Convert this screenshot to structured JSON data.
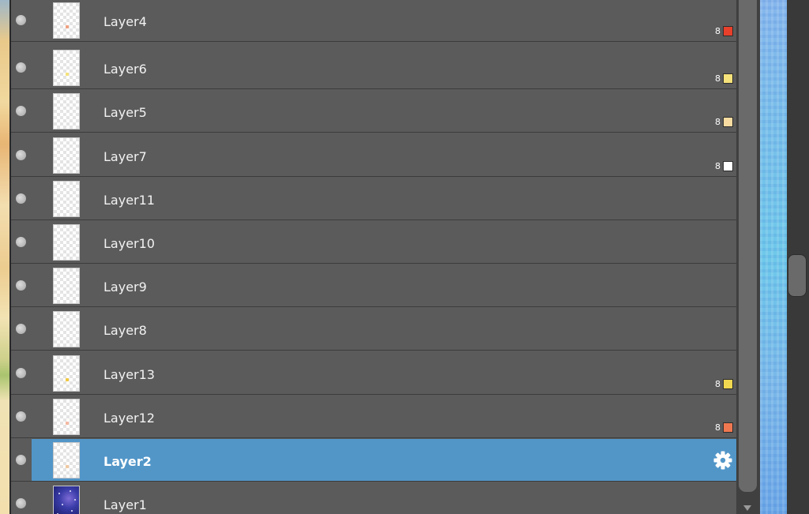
{
  "layers": [
    {
      "name": "Layer4",
      "tag": "8",
      "tag_color": "#e8402a",
      "thumb_mark": "#f0a080",
      "selected": false
    },
    {
      "name": "Layer6",
      "tag": "8",
      "tag_color": "#f6e27a",
      "thumb_mark": "#f4e27a",
      "selected": false
    },
    {
      "name": "Layer5",
      "tag": "8",
      "tag_color": "#f8dba0",
      "thumb_mark": null,
      "selected": false
    },
    {
      "name": "Layer7",
      "tag": "8",
      "tag_color": "#ffffff",
      "thumb_mark": null,
      "selected": false
    },
    {
      "name": "Layer11",
      "tag": null,
      "tag_color": null,
      "thumb_mark": null,
      "selected": false
    },
    {
      "name": "Layer10",
      "tag": null,
      "tag_color": null,
      "thumb_mark": null,
      "selected": false
    },
    {
      "name": "Layer9",
      "tag": null,
      "tag_color": null,
      "thumb_mark": null,
      "selected": false
    },
    {
      "name": "Layer8",
      "tag": null,
      "tag_color": null,
      "thumb_mark": null,
      "selected": false
    },
    {
      "name": "Layer13",
      "tag": "8",
      "tag_color": "#f0d850",
      "thumb_mark": "#f0c840",
      "selected": false
    },
    {
      "name": "Layer12",
      "tag": "8",
      "tag_color": "#f07850",
      "thumb_mark": "#f4b8a0",
      "selected": false
    },
    {
      "name": "Layer2",
      "tag": null,
      "tag_color": null,
      "thumb_mark": "#f0c8a0",
      "selected": true,
      "settings_icon": "gear-icon"
    },
    {
      "name": "Layer1",
      "tag": null,
      "tag_color": null,
      "thumb_mark": null,
      "selected": false,
      "thumb_style": "galaxy"
    }
  ],
  "colors": {
    "panel_bg": "#5b5b5b",
    "selected_bg": "#5296c8",
    "row_divider": "#3c3c3c"
  }
}
